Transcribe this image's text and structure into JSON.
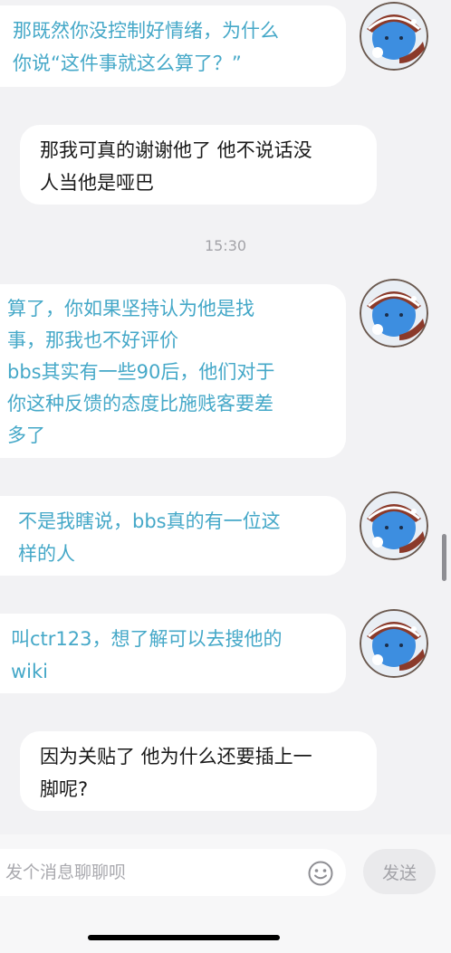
{
  "messages": [
    {
      "text": "那既然你没控制好情绪，为什么\n你说“这件事就这么算了？”",
      "side": "left",
      "color": "teal",
      "avatar": true
    },
    {
      "text": "那我可真的谢谢他了 他不说话没\n人当他是哑巴",
      "side": "right",
      "color": "dark",
      "avatar": false
    },
    {
      "text": "算了，你如果坚持认为他是找\n事，那我也不好评价\nbbs其实有一些90后，他们对于\n你这种反馈的态度比施贱客要差\n多了",
      "side": "left",
      "color": "teal",
      "avatar": true
    },
    {
      "text": "不是我瞎说，bbs真的有一位这\n样的人",
      "side": "left",
      "color": "teal",
      "avatar": true
    },
    {
      "text": "叫ctr123，想了解可以去搜他的\nwiki",
      "side": "left",
      "color": "teal",
      "avatar": true
    },
    {
      "text": "因为关贴了 他为什么还要插上一\n脚呢?",
      "side": "right",
      "color": "dark",
      "avatar": false
    }
  ],
  "timestamp": "15:30",
  "input": {
    "placeholder": "发个消息聊聊呗",
    "value": ""
  },
  "send_label": "发送",
  "colors": {
    "teal_text": "#45a8c8",
    "dark_text": "#1a1a1a",
    "background": "#f2f2f4",
    "avatar_blue": "#3d8ee0",
    "avatar_brown": "#8b3a2a"
  }
}
